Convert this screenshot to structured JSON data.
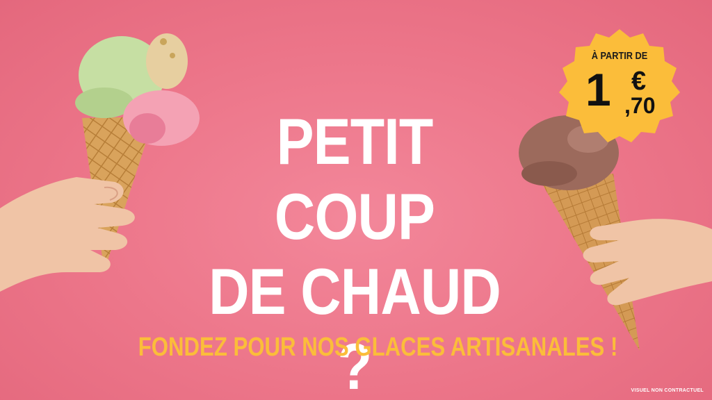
{
  "headline": {
    "line1": "PETIT COUP",
    "line2": "DE CHAUD ?"
  },
  "tagline": "FONDEZ POUR NOS GLACES ARTISANALES !",
  "disclaimer": "VISUEL NON CONTRACTUEL",
  "price_badge": {
    "prefix": "À PARTIR DE",
    "integer_part": "1",
    "currency": "€",
    "decimal_part": ",70"
  },
  "colors": {
    "background": "#ec7589",
    "headline": "#ffffff",
    "tagline": "#fbbd3a",
    "badge": "#fbbd3a"
  },
  "illustrations": [
    "pistachio-strawberry-cone-in-hand",
    "chocolate-cone-in-hand"
  ]
}
